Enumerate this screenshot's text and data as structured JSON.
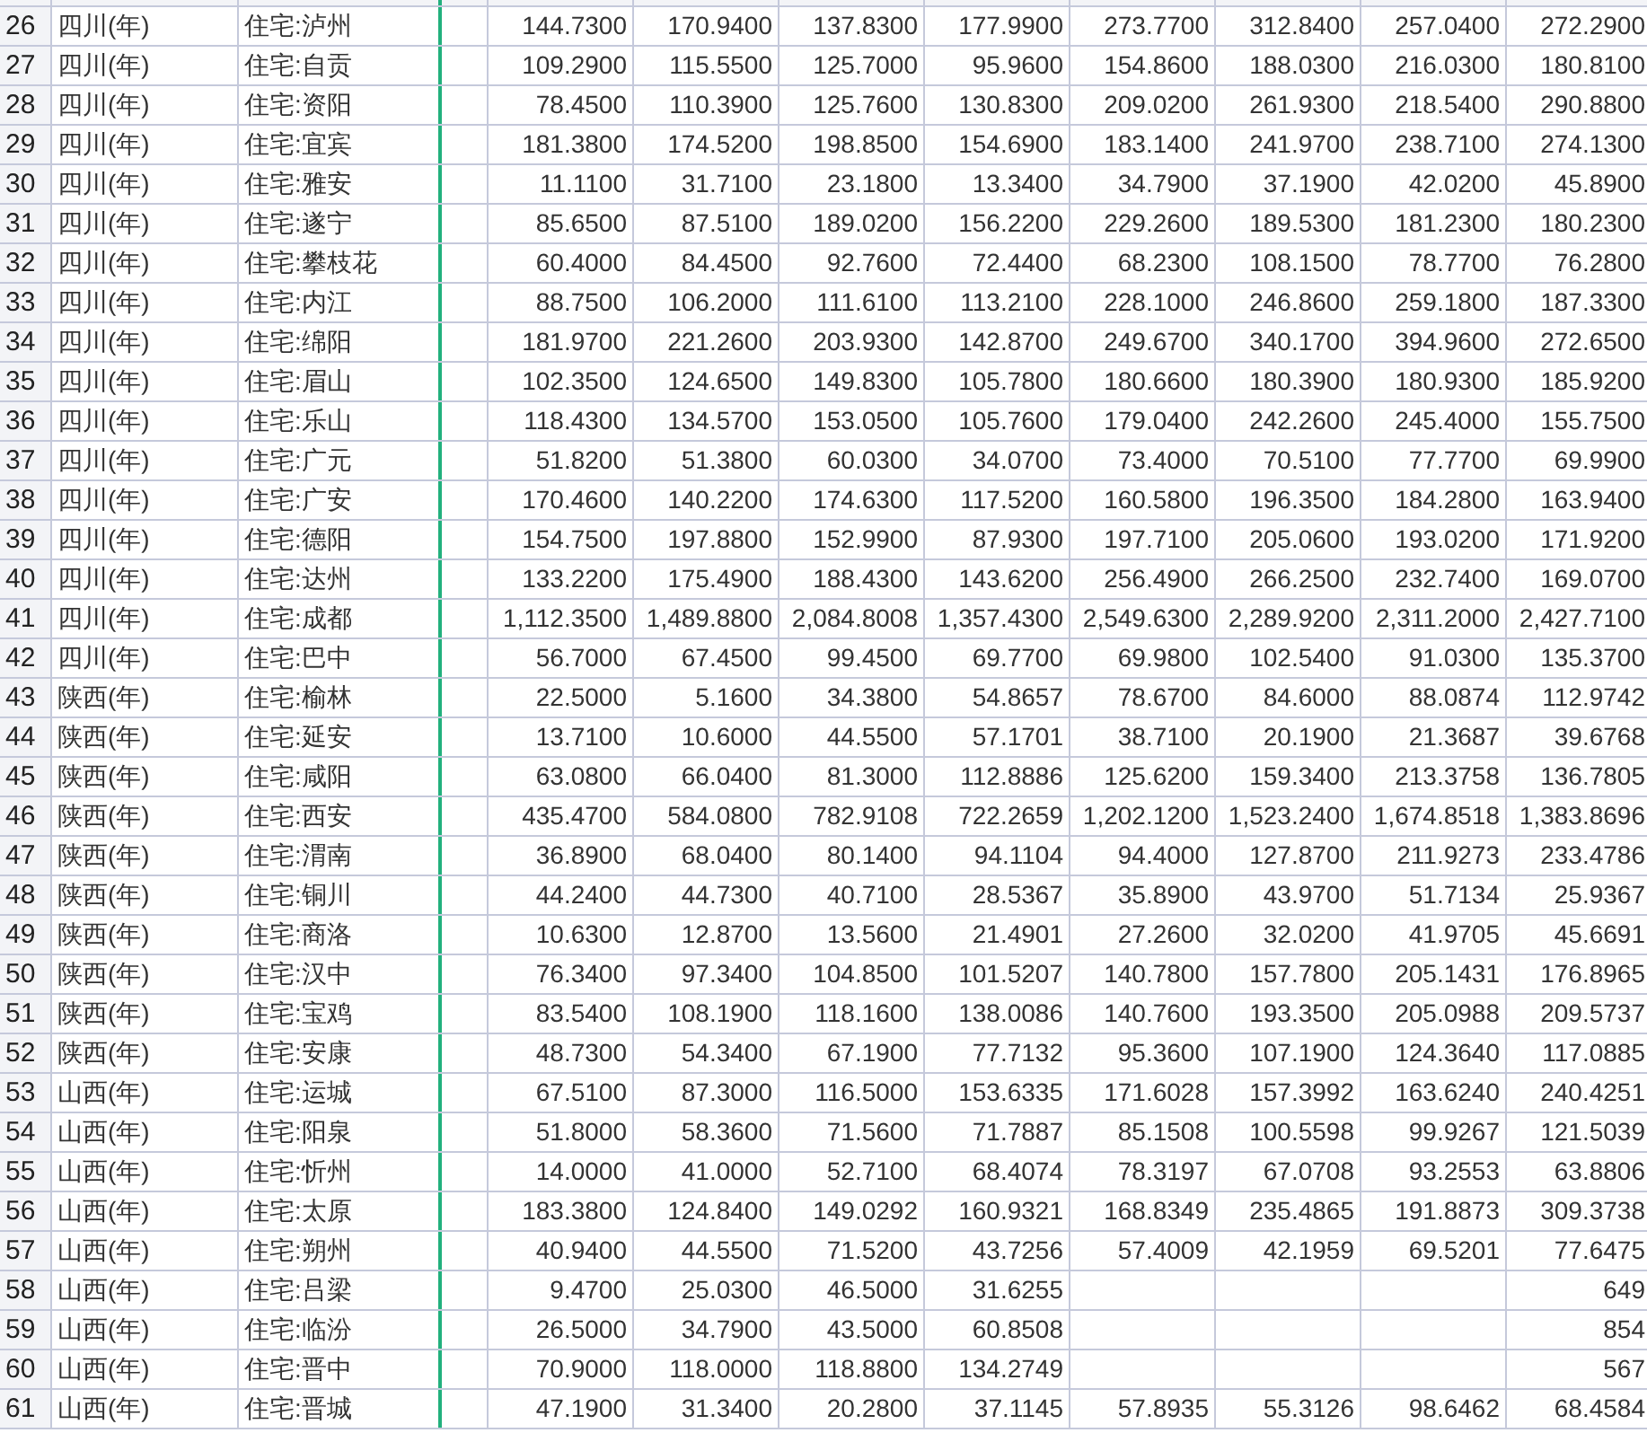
{
  "rows": [
    {
      "row_number": "26",
      "cells": [
        "四川(年)",
        "住宅:泸州",
        "144.7300",
        "170.9400",
        "137.8300",
        "177.9900",
        "273.7700",
        "312.8400",
        "257.0400",
        "272.2900"
      ]
    },
    {
      "row_number": "27",
      "cells": [
        "四川(年)",
        "住宅:自贡",
        "109.2900",
        "115.5500",
        "125.7000",
        "95.9600",
        "154.8600",
        "188.0300",
        "216.0300",
        "180.8100"
      ]
    },
    {
      "row_number": "28",
      "cells": [
        "四川(年)",
        "住宅:资阳",
        "78.4500",
        "110.3900",
        "125.7600",
        "130.8300",
        "209.0200",
        "261.9300",
        "218.5400",
        "290.8800"
      ]
    },
    {
      "row_number": "29",
      "cells": [
        "四川(年)",
        "住宅:宜宾",
        "181.3800",
        "174.5200",
        "198.8500",
        "154.6900",
        "183.1400",
        "241.9700",
        "238.7100",
        "274.1300"
      ]
    },
    {
      "row_number": "30",
      "cells": [
        "四川(年)",
        "住宅:雅安",
        "11.1100",
        "31.7100",
        "23.1800",
        "13.3400",
        "34.7900",
        "37.1900",
        "42.0200",
        "45.8900"
      ]
    },
    {
      "row_number": "31",
      "cells": [
        "四川(年)",
        "住宅:遂宁",
        "85.6500",
        "87.5100",
        "189.0200",
        "156.2200",
        "229.2600",
        "189.5300",
        "181.2300",
        "180.2300"
      ]
    },
    {
      "row_number": "32",
      "cells": [
        "四川(年)",
        "住宅:攀枝花",
        "60.4000",
        "84.4500",
        "92.7600",
        "72.4400",
        "68.2300",
        "108.1500",
        "78.7700",
        "76.2800"
      ]
    },
    {
      "row_number": "33",
      "cells": [
        "四川(年)",
        "住宅:内江",
        "88.7500",
        "106.2000",
        "111.6100",
        "113.2100",
        "228.1000",
        "246.8600",
        "259.1800",
        "187.3300"
      ]
    },
    {
      "row_number": "34",
      "cells": [
        "四川(年)",
        "住宅:绵阳",
        "181.9700",
        "221.2600",
        "203.9300",
        "142.8700",
        "249.6700",
        "340.1700",
        "394.9600",
        "272.6500"
      ]
    },
    {
      "row_number": "35",
      "cells": [
        "四川(年)",
        "住宅:眉山",
        "102.3500",
        "124.6500",
        "149.8300",
        "105.7800",
        "180.6600",
        "180.3900",
        "180.9300",
        "185.9200"
      ]
    },
    {
      "row_number": "36",
      "cells": [
        "四川(年)",
        "住宅:乐山",
        "118.4300",
        "134.5700",
        "153.0500",
        "105.7600",
        "179.0400",
        "242.2600",
        "245.4000",
        "155.7500"
      ]
    },
    {
      "row_number": "37",
      "cells": [
        "四川(年)",
        "住宅:广元",
        "51.8200",
        "51.3800",
        "60.0300",
        "34.0700",
        "73.4000",
        "70.5100",
        "77.7700",
        "69.9900"
      ]
    },
    {
      "row_number": "38",
      "cells": [
        "四川(年)",
        "住宅:广安",
        "170.4600",
        "140.2200",
        "174.6300",
        "117.5200",
        "160.5800",
        "196.3500",
        "184.2800",
        "163.9400"
      ]
    },
    {
      "row_number": "39",
      "cells": [
        "四川(年)",
        "住宅:德阳",
        "154.7500",
        "197.8800",
        "152.9900",
        "87.9300",
        "197.7100",
        "205.0600",
        "193.0200",
        "171.9200"
      ]
    },
    {
      "row_number": "40",
      "cells": [
        "四川(年)",
        "住宅:达州",
        "133.2200",
        "175.4900",
        "188.4300",
        "143.6200",
        "256.4900",
        "266.2500",
        "232.7400",
        "169.0700"
      ]
    },
    {
      "row_number": "41",
      "cells": [
        "四川(年)",
        "住宅:成都",
        "1,112.3500",
        "1,489.8800",
        "2,084.8008",
        "1,357.4300",
        "2,549.6300",
        "2,289.9200",
        "2,311.2000",
        "2,427.7100"
      ]
    },
    {
      "row_number": "42",
      "cells": [
        "四川(年)",
        "住宅:巴中",
        "56.7000",
        "67.4500",
        "99.4500",
        "69.7700",
        "69.9800",
        "102.5400",
        "91.0300",
        "135.3700"
      ]
    },
    {
      "row_number": "43",
      "cells": [
        "陕西(年)",
        "住宅:榆林",
        "22.5000",
        "5.1600",
        "34.3800",
        "54.8657",
        "78.6700",
        "84.6000",
        "88.0874",
        "112.9742"
      ]
    },
    {
      "row_number": "44",
      "cells": [
        "陕西(年)",
        "住宅:延安",
        "13.7100",
        "10.6000",
        "44.5500",
        "57.1701",
        "38.7100",
        "20.1900",
        "21.3687",
        "39.6768"
      ]
    },
    {
      "row_number": "45",
      "cells": [
        "陕西(年)",
        "住宅:咸阳",
        "63.0800",
        "66.0400",
        "81.3000",
        "112.8886",
        "125.6200",
        "159.3400",
        "213.3758",
        "136.7805"
      ]
    },
    {
      "row_number": "46",
      "cells": [
        "陕西(年)",
        "住宅:西安",
        "435.4700",
        "584.0800",
        "782.9108",
        "722.2659",
        "1,202.1200",
        "1,523.2400",
        "1,674.8518",
        "1,383.8696"
      ]
    },
    {
      "row_number": "47",
      "cells": [
        "陕西(年)",
        "住宅:渭南",
        "36.8900",
        "68.0400",
        "80.1400",
        "94.1104",
        "94.4000",
        "127.8700",
        "211.9273",
        "233.4786"
      ]
    },
    {
      "row_number": "48",
      "cells": [
        "陕西(年)",
        "住宅:铜川",
        "44.2400",
        "44.7300",
        "40.7100",
        "28.5367",
        "35.8900",
        "43.9700",
        "51.7134",
        "25.9367"
      ]
    },
    {
      "row_number": "49",
      "cells": [
        "陕西(年)",
        "住宅:商洛",
        "10.6300",
        "12.8700",
        "13.5600",
        "21.4901",
        "27.2600",
        "32.0200",
        "41.9705",
        "45.6691"
      ]
    },
    {
      "row_number": "50",
      "cells": [
        "陕西(年)",
        "住宅:汉中",
        "76.3400",
        "97.3400",
        "104.8500",
        "101.5207",
        "140.7800",
        "157.7800",
        "205.1431",
        "176.8965"
      ]
    },
    {
      "row_number": "51",
      "cells": [
        "陕西(年)",
        "住宅:宝鸡",
        "83.5400",
        "108.1900",
        "118.1600",
        "138.0086",
        "140.7600",
        "193.3500",
        "205.0988",
        "209.5737"
      ]
    },
    {
      "row_number": "52",
      "cells": [
        "陕西(年)",
        "住宅:安康",
        "48.7300",
        "54.3400",
        "67.1900",
        "77.7132",
        "95.3600",
        "107.1900",
        "124.3640",
        "117.0885"
      ]
    },
    {
      "row_number": "53",
      "cells": [
        "山西(年)",
        "住宅:运城",
        "67.5100",
        "87.3000",
        "116.5000",
        "153.6335",
        "171.6028",
        "157.3992",
        "163.6240",
        "240.4251"
      ]
    },
    {
      "row_number": "54",
      "cells": [
        "山西(年)",
        "住宅:阳泉",
        "51.8000",
        "58.3600",
        "71.5600",
        "71.7887",
        "85.1508",
        "100.5598",
        "99.9267",
        "121.5039"
      ]
    },
    {
      "row_number": "55",
      "cells": [
        "山西(年)",
        "住宅:忻州",
        "14.0000",
        "41.0000",
        "52.7100",
        "68.4074",
        "78.3197",
        "67.0708",
        "93.2553",
        "63.8806"
      ]
    },
    {
      "row_number": "56",
      "cells": [
        "山西(年)",
        "住宅:太原",
        "183.3800",
        "124.8400",
        "149.0292",
        "160.9321",
        "168.8349",
        "235.4865",
        "191.8873",
        "309.3738"
      ]
    },
    {
      "row_number": "57",
      "cells": [
        "山西(年)",
        "住宅:朔州",
        "40.9400",
        "44.5500",
        "71.5200",
        "43.7256",
        "57.4009",
        "42.1959",
        "69.5201",
        "77.6475"
      ]
    },
    {
      "row_number": "58",
      "cells": [
        "山西(年)",
        "住宅:吕梁",
        "9.4700",
        "25.0300",
        "46.5000",
        "31.6255",
        null,
        null,
        null,
        "649"
      ]
    },
    {
      "row_number": "59",
      "cells": [
        "山西(年)",
        "住宅:临汾",
        "26.5000",
        "34.7900",
        "43.5000",
        "60.8508",
        null,
        null,
        null,
        "854"
      ]
    },
    {
      "row_number": "60",
      "cells": [
        "山西(年)",
        "住宅:晋中",
        "70.9000",
        "118.0000",
        "118.8800",
        "134.2749",
        null,
        null,
        null,
        "567"
      ]
    },
    {
      "row_number": "61",
      "cells": [
        "山西(年)",
        "住宅:晋城",
        "47.1900",
        "31.3400",
        "20.2800",
        "37.1145",
        "57.8935",
        "55.3126",
        "98.6462",
        "68.4584"
      ]
    }
  ]
}
